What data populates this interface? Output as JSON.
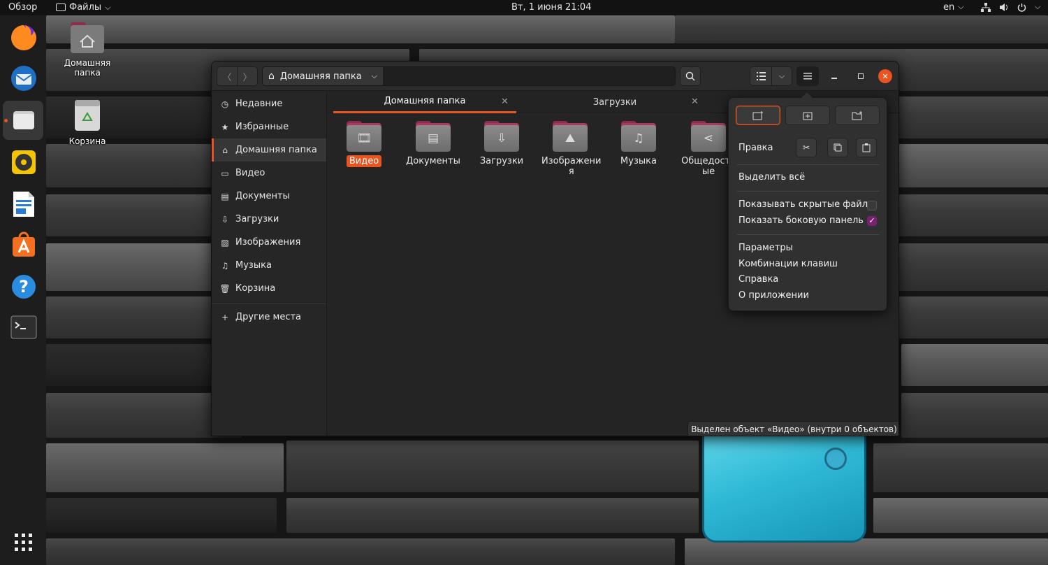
{
  "topbar": {
    "activities": "Обзор",
    "app_menu": "Файлы",
    "app_menu_arrow": "⌵",
    "datetime": "Вт, 1 июня  21:04",
    "language": "en",
    "language_arrow": "⌵"
  },
  "desktop": {
    "home_label": "Домашняя папка",
    "trash_label": "Корзина"
  },
  "window": {
    "path_label": "Домашняя папка",
    "tabs": [
      {
        "label": "Домашняя папка",
        "active": true
      },
      {
        "label": "Загрузки",
        "active": false
      }
    ],
    "sidebar": {
      "items": [
        {
          "label": "Недавние",
          "icon": "clock-icon",
          "glyph": "◷"
        },
        {
          "label": "Избранные",
          "icon": "star-icon",
          "glyph": "★"
        },
        {
          "label": "Домашняя папка",
          "icon": "home-icon",
          "glyph": "⌂"
        },
        {
          "label": "Видео",
          "icon": "film-icon",
          "glyph": "▭"
        },
        {
          "label": "Документы",
          "icon": "document-icon",
          "glyph": "▤"
        },
        {
          "label": "Загрузки",
          "icon": "download-icon",
          "glyph": "⇩"
        },
        {
          "label": "Изображения",
          "icon": "image-icon",
          "glyph": "▨"
        },
        {
          "label": "Музыка",
          "icon": "music-icon",
          "glyph": "♫"
        },
        {
          "label": "Корзина",
          "icon": "trash-icon",
          "glyph": "🗑"
        }
      ],
      "other_places": "Другие места"
    },
    "files": [
      {
        "label": "Видео",
        "icon": "film-icon",
        "glyph": "🎞"
      },
      {
        "label": "Документы",
        "icon": "document-icon",
        "glyph": "▤"
      },
      {
        "label": "Загрузки",
        "icon": "download-icon",
        "glyph": "⇩"
      },
      {
        "label": "Изображени\nя",
        "icon": "image-icon",
        "glyph": "⛰"
      },
      {
        "label": "Музыка",
        "icon": "music-icon",
        "glyph": "♫"
      },
      {
        "label": "Общедосту\nые",
        "icon": "share-icon",
        "glyph": "⋖"
      }
    ],
    "status": "Выделен объект «Видео»  (внутри 0 объектов)"
  },
  "menu": {
    "edit_label": "Правка",
    "select_all": "Выделить всё",
    "show_hidden": "Показывать скрытые файлы",
    "show_sidebar": "Показать боковую панель",
    "preferences": "Параметры",
    "shortcuts": "Комбинации клавиш",
    "help": "Справка",
    "about": "О приложении",
    "show_hidden_checked": false,
    "show_sidebar_checked": true
  },
  "colors": {
    "accent": "#e95420",
    "checkbox": "#77216f"
  }
}
